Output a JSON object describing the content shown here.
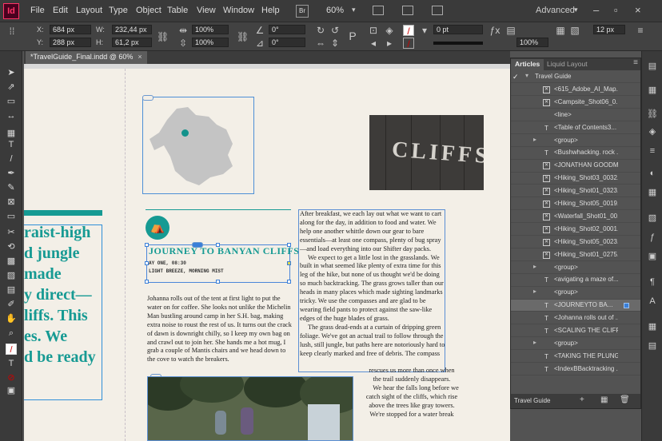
{
  "app": {
    "logo": "Id",
    "zoom": "60%",
    "workspace": "Advanced",
    "bridge_label": "Br"
  },
  "menu": [
    "File",
    "Edit",
    "Layout",
    "Type",
    "Object",
    "Table",
    "View",
    "Window",
    "Help"
  ],
  "control": {
    "x_label": "X:",
    "x_value": "684 px",
    "y_label": "Y:",
    "y_value": "288 px",
    "w_label": "W:",
    "w_value": "232,44 px",
    "h_label": "H:",
    "h_value": "61,2 px",
    "scale_x": "100%",
    "scale_y": "100%",
    "rotate": "0°",
    "shear": "0°",
    "stroke_weight": "0 pt",
    "stroke_pct": "100%",
    "col_value": "12 px"
  },
  "document_tab": {
    "title": "*TravelGuide_Final.indd @ 60%",
    "close": "×"
  },
  "canvas": {
    "big_headline_lines": [
      "raist-high",
      "d jungle",
      "made",
      "y direct—",
      "liffs. This",
      "es. We",
      "d be ready"
    ],
    "photo_word": "CLIFFS",
    "article_title": "JOURNEY TO BANYAN CLIFFS",
    "byline_1": "AY ONE, 08:30",
    "byline_2": "LIGHT BREEZE, MORNING MIST",
    "column1_text": "Johanna rolls out of the tent at first light to put the water on for coffee. She looks not unlike the Michelin Man bustling around camp in her S.H. bag, making extra noise to roust the rest of us. It turns out the crack of dawn is downright chilly, so I keep my own bag on and crawl out to join her. She hands me a hot mug, I grab a couple of Mantis chairs and we head down to the cove to watch the breakers.",
    "column2_para1": "After breakfast, we each lay out what we want to cart along for the day, in addition to food and water. We help one another whittle down our gear to bare essentials—at least one compass, plenty of bug spray—and load everything into our Shifter day packs.",
    "column2_para2": "We expect to get a little lost in the grasslands. We built in what seemed like plenty of extra time for this leg of the hike, but none of us thought we'd be doing so much backtracking. The grass grows taller than our heads in many places which made sighting landmarks tricky. We use the compasses and are glad to be wearing field pants to protect against the saw-like edges of the huge blades of grass.",
    "column2_para3": "The grass dead-ends at a curtain of dripping green foliage. We've got an actual trail to follow through the lush, still jungle, but paths here are notoriously hard to keep clearly marked and free of debris. The compass",
    "column3_text": "rescues us more than once when the trail suddenly disappears.",
    "column3_para2": "We hear the falls long before we catch sight of the cliffs, which rise above the trees like gray towers. We're stopped for a water break"
  },
  "articles_panel": {
    "tabs": [
      "Articles",
      "Liquid Layout"
    ],
    "menu_icon": "≡",
    "rows": [
      {
        "label": "Travel Guide",
        "icon": "",
        "root": true
      },
      {
        "label": "<615_Adobe_AI_Map...",
        "icon": "x"
      },
      {
        "label": "<Campsite_Shot06_0...",
        "icon": "x"
      },
      {
        "label": "<line>",
        "icon": ""
      },
      {
        "label": "<Table of Contents3...",
        "icon": "T"
      },
      {
        "label": "<group>",
        "icon": "",
        "group": true
      },
      {
        "label": "<Bushwhacking. rock ...",
        "icon": "T"
      },
      {
        "label": "<JONATHAN GOODM...",
        "icon": "x"
      },
      {
        "label": "<Hiking_Shot03_0032...",
        "icon": "x"
      },
      {
        "label": "<Hiking_Shot01_0323...",
        "icon": "x"
      },
      {
        "label": "<Hiking_Shot05_0019...",
        "icon": "x"
      },
      {
        "label": "<Waterfall_Shot01_00...",
        "icon": "x"
      },
      {
        "label": "<Hiking_Shot02_0001...",
        "icon": "x"
      },
      {
        "label": "<Hiking_Shot05_0023...",
        "icon": "x"
      },
      {
        "label": "<Hiking_Shot01_0275...",
        "icon": "x"
      },
      {
        "label": "<group>",
        "icon": "",
        "group": true
      },
      {
        "label": "<avigating a maze of...",
        "icon": "T"
      },
      {
        "label": "<group>",
        "icon": "",
        "group": true
      },
      {
        "label": "<JOURNEYTO BA...",
        "icon": "T",
        "selected": true
      },
      {
        "label": "<Johanna rolls out of ...",
        "icon": "T"
      },
      {
        "label": "<SCALING THE CLIFF...",
        "icon": "T"
      },
      {
        "label": "<group>",
        "icon": "",
        "group": true
      },
      {
        "label": "<TAKING THE PLUNG...",
        "icon": "T"
      },
      {
        "label": "<IndexBBacktracking ...",
        "icon": "T"
      }
    ],
    "footer_name": "Travel Guide"
  }
}
